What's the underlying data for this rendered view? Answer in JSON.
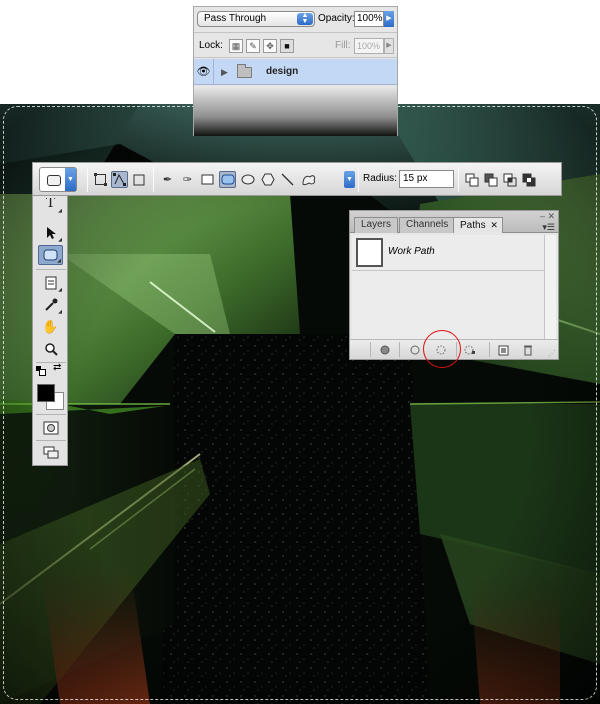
{
  "layers_panel": {
    "blend_mode": "Pass Through",
    "opacity_label": "Opacity:",
    "opacity_value": "100%",
    "lock_label": "Lock:",
    "fill_label": "Fill:",
    "fill_value": "100%",
    "layer": {
      "name": "design",
      "visible_icon": "eye-icon",
      "type_icon": "folder-icon"
    }
  },
  "options_bar": {
    "radius_label": "Radius:",
    "radius_value": "15 px",
    "path_mode_buttons": [
      "shape-layers-icon",
      "paths-icon",
      "fill-pixels-icon"
    ],
    "drawing_tools": [
      "pen-icon",
      "freeform-pen-icon",
      "rectangle-icon",
      "rounded-rectangle-icon",
      "ellipse-icon",
      "polygon-icon",
      "line-icon",
      "custom-shape-icon"
    ],
    "combine_buttons": [
      "add-icon",
      "subtract-icon",
      "intersect-icon",
      "exclude-icon"
    ]
  },
  "tools_panel": {
    "tools": [
      "type-icon",
      "path-selection-icon",
      "rounded-rectangle-icon",
      "notes-icon",
      "eyedropper-icon",
      "hand-icon",
      "zoom-icon",
      "quick-mask-icon",
      "screen-mode-icon"
    ],
    "foreground_color": "#000000",
    "background_color": "#ffffff"
  },
  "paths_panel": {
    "tabs": [
      "Layers",
      "Channels",
      "Paths"
    ],
    "active_tab": "Paths",
    "paths": [
      {
        "name": "Work Path"
      }
    ],
    "footer_buttons": [
      "fill-path-icon",
      "stroke-path-icon",
      "load-path-as-selection-icon",
      "make-work-path-icon",
      "new-path-icon",
      "delete-path-icon"
    ]
  },
  "colors": {
    "highlight": "#e01010",
    "selected_layer": "#c3d8f5",
    "accent_blue": "#2d6bc8"
  }
}
